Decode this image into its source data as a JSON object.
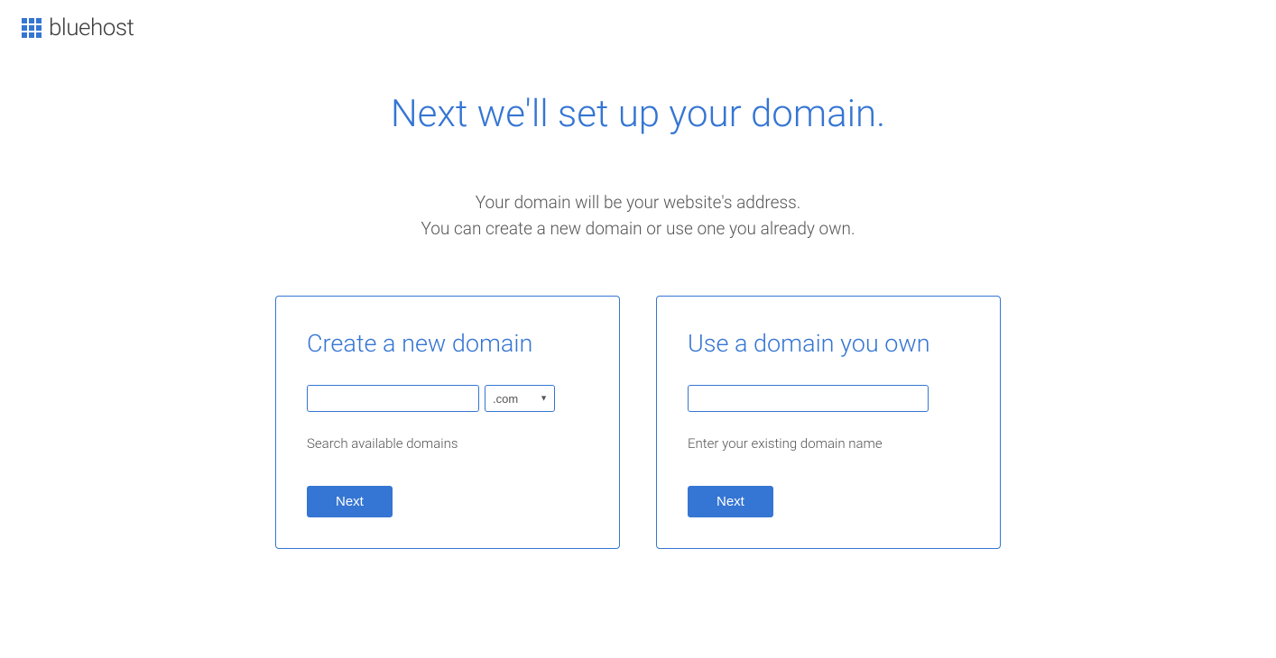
{
  "brand": "bluehost",
  "page_title": "Next we'll set up your domain.",
  "subtitle_line1": "Your domain will be your website's address.",
  "subtitle_line2": "You can create a new domain or use one you already own.",
  "create_card": {
    "title": "Create a new domain",
    "tld_selected": ".com",
    "hint": "Search available domains",
    "button": "Next"
  },
  "existing_card": {
    "title": "Use a domain you own",
    "hint": "Enter your existing domain name",
    "button": "Next"
  }
}
